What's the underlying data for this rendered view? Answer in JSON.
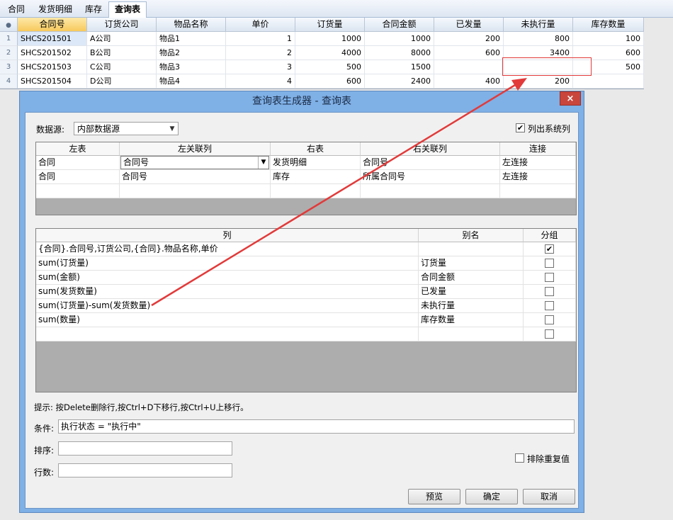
{
  "tabs": [
    "合同",
    "发货明细",
    "库存",
    "查询表"
  ],
  "grid": {
    "headers": [
      "合同号",
      "订货公司",
      "物品名称",
      "单价",
      "订货量",
      "合同金额",
      "已发量",
      "未执行量",
      "库存数量"
    ],
    "rows": [
      {
        "n": "1",
        "c": [
          "SHCS201501",
          "A公司",
          "物品1",
          "1",
          "1000",
          "1000",
          "200",
          "800",
          "100"
        ]
      },
      {
        "n": "2",
        "c": [
          "SHCS201502",
          "B公司",
          "物品2",
          "2",
          "4000",
          "8000",
          "600",
          "3400",
          "600"
        ]
      },
      {
        "n": "3",
        "c": [
          "SHCS201503",
          "C公司",
          "物品3",
          "3",
          "500",
          "1500",
          "",
          "",
          "500"
        ]
      },
      {
        "n": "4",
        "c": [
          "SHCS201504",
          "D公司",
          "物品4",
          "4",
          "600",
          "2400",
          "400",
          "200",
          ""
        ]
      }
    ]
  },
  "dialog": {
    "title": "查询表生成器 - 查询表",
    "close": "×",
    "datasource_label": "数据源:",
    "datasource_value": "内部数据源",
    "list_system_columns_label": "列出系统列",
    "list_system_columns_checked": true,
    "join_table": {
      "headers": [
        "左表",
        "左关联列",
        "右表",
        "右关联列",
        "连接"
      ],
      "rows": [
        [
          "合同",
          "合同号",
          "发货明细",
          "合同号",
          "左连接"
        ],
        [
          "合同",
          "合同号",
          "库存",
          "所属合同号",
          "左连接"
        ]
      ]
    },
    "column_table": {
      "headers": [
        "列",
        "别名",
        "分组"
      ],
      "rows": [
        {
          "col": "{合同}.合同号,订货公司,{合同}.物品名称,单价",
          "alias": "",
          "group": true
        },
        {
          "col": "sum(订货量)",
          "alias": "订货量",
          "group": false
        },
        {
          "col": "sum(金额)",
          "alias": "合同金额",
          "group": false
        },
        {
          "col": "sum(发货数量)",
          "alias": "已发量",
          "group": false
        },
        {
          "col": "sum(订货量)-sum(发货数量)",
          "alias": "未执行量",
          "group": false
        },
        {
          "col": "sum(数量)",
          "alias": "库存数量",
          "group": false
        },
        {
          "col": "",
          "alias": "",
          "group": false
        }
      ]
    },
    "hint": "提示: 按Delete删除行,按Ctrl+D下移行,按Ctrl+U上移行。",
    "condition_label": "条件:",
    "condition_value": "执行状态 = \"执行中\"",
    "sort_label": "排序:",
    "sort_value": "",
    "rows_label": "行数:",
    "rows_value": "",
    "distinct_label": "排除重复值",
    "distinct_checked": false,
    "buttons": {
      "preview": "预览",
      "ok": "确定",
      "cancel": "取消"
    }
  },
  "colors": {
    "annotation_red": "#e23a3a",
    "dialog_frame": "#7fb0e6",
    "selected_header": "#f7c95c"
  }
}
